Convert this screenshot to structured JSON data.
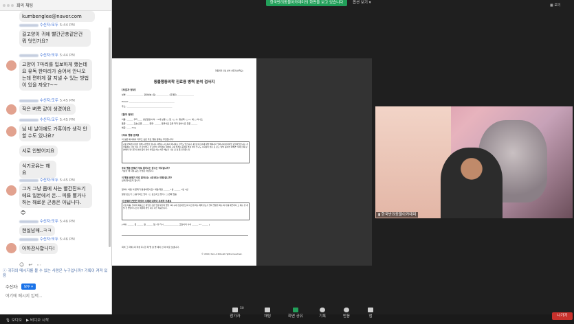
{
  "chat": {
    "title": "회의 채팅",
    "top_email": "kumbenglee@naver.com",
    "messages": [
      {
        "meta_name": "수신자:모두",
        "time": "5:44 PM",
        "text": "길고양이 귀에 빨간곤충같은건 뭐 엇인가요?"
      },
      {
        "meta_name": "수신자:모두",
        "time": "5:44 PM",
        "text": "고양이 7마리를 입보하게 했는데요 유독 한마리가 숨어서 안나오는데 편하게 잘 지낼 수 있는 방법이 있을 까요?~~"
      },
      {
        "meta_name": "수신자:모두",
        "time": "5:45 PM",
        "text": "작은 벼룩 같이 생겼어요"
      },
      {
        "meta_name": "수신자:모두",
        "time": "5:45 PM",
        "text": "님 네 날이에도 가혹이라 생각 안 할 수도 있나요?"
      },
      {
        "meta_name": "",
        "time": "",
        "text": "서로 안봤어지요"
      },
      {
        "meta_name": "",
        "time": "",
        "text": "식기공유는 해요"
      },
      {
        "meta_name": "수신자:모두",
        "time": "5:45 PM",
        "text": "그거 그냥 몸에 사는 빨간진드기에요 일본에서 온... 피를 빨거나 하는 해로운 곤충은 아닙니다."
      },
      {
        "meta_name": "",
        "time": "",
        "text": "😊"
      },
      {
        "meta_name": "수신자:모두",
        "time": "5:46 PM",
        "text": "현실남매..ㅋㅋ"
      },
      {
        "meta_name": "수신자:모두",
        "time": "5:46 PM",
        "text": "아하감사합니다!"
      }
    ],
    "warning": "귀하의 메시지를 볼 수 있는 사람은 누구입니까? 기록이 켜져 있음",
    "recipient_label": "수신자:",
    "recipient_value": "모두",
    "input_placeholder": "여기에 메시지 입력..."
  },
  "topbar": {
    "share_banner": "한국반려동물아카데미의 화면을 보고 있습니다",
    "options": "옵션 보기",
    "view": "보기"
  },
  "document": {
    "header_right": "행동의학 진료 분석 설문지(반려묘)",
    "title": "동물행동의학 진료용 병력 분석 검사지",
    "owner_section": "[보호자 정보]",
    "owner_name": "성명: ________________  관련번호 (집) ____________ (휴대폰) ________________",
    "email": "Email: ____________________________________________",
    "address": "주소: ____________________________________________",
    "patient_section": "[환자 정보]",
    "patient_name": "이름: ______ 쿠티 ____  생년월일/나이: 11세  성별: □ 암 / □ 수, 중성화: □ o / 예 □ 아니오",
    "breed": "품종: ______ 코숏/혼종 ______ 종류: ______ 동물치료 모을 화자 일어나온 질문 ______",
    "weight": "체중: ____ 3 kg",
    "problem_section": "[주요 행동 문제]",
    "problem_question": "이 설문 에서에서 다루고 싶은 주요 행동 문제는 무엇입니까?",
    "problem_box": "기분 변하게 기침을 위해 구역질을 합니다. 패밀는 구토하지 아니하는 경우도 있습니다. 평 넷 이집(6개 재발 해대지가 일어나며 처리이었 모임이었습니다. 저 행동에는 한같 이는 한 집났었다. 한 장인이 커리에는 재하를 고를 콜레는 몸이를 결정 이야 좋구도 기회정이 맞는 요 보고 '양이 동이면 피해면' 되에 한쪽 장면에의 데 다른까 설명 등이 많이 아있죠 하는 하유 해보기 나는 것 점 좀 진행됩니다.",
    "q1": "주요 행동 문제가 주로 일어나는 장소는 어디입니까?",
    "q1_ans": "거실할 때 자유 공소가 많은 아닙니다.",
    "q2": "이 행동 문제가 주로 일어나는 시간(또는 언제)입니까?",
    "q2_ans": "언제 몇이든지 합니다",
    "q3": "일어나 처음 이 문제가 발생하였나요? 세월/개월 ______ 1살   ______   1번   1번",
    "q3_sub": "발생 빈도가 □ 증가하고 있다 / □ 감소하고 있다 / □ 변화 없음",
    "q4": "이 문제와 관련한 최초의 사례에 대하여 자세히 주세요",
    "q4_box": "가장 처음, 들어와 처음으로 확인한 것은 입양 피부하 몇번 5회 구내 진료하였으며 다르게 하는 체액 빈도가 일어 몇번은 하는 피가 좀 깨끗하지 고 제는 한 개월 첫 몇번이 다르기 때문에 원인 과는 다른 처음입니다.",
    "signature": "[서체: ______ 년 ______ 월 ______ 일 / 취 다시 ______________ 고양이의 나이 ______ 11 ______ ]",
    "footer_note": "피어 그 자체 (의 작성 후) 한 제 명 설 명 에이 선 이 바로 보냅니다.",
    "copyright": "© 2020, Sun A Kim all rights reserved."
  },
  "video": {
    "name": "한국반려동물아카데미"
  },
  "bottombar": {
    "left_items": [
      "오디오",
      "비디오 시작"
    ],
    "participants_count": "50",
    "buttons": [
      "참가자",
      "채팅",
      "화면 공유",
      "기록",
      "반응",
      "앱"
    ],
    "leave": "나가기"
  },
  "colors": {
    "share_green": "#22a05a",
    "leave_red": "#c8312c",
    "link_blue": "#3b6fd8"
  }
}
